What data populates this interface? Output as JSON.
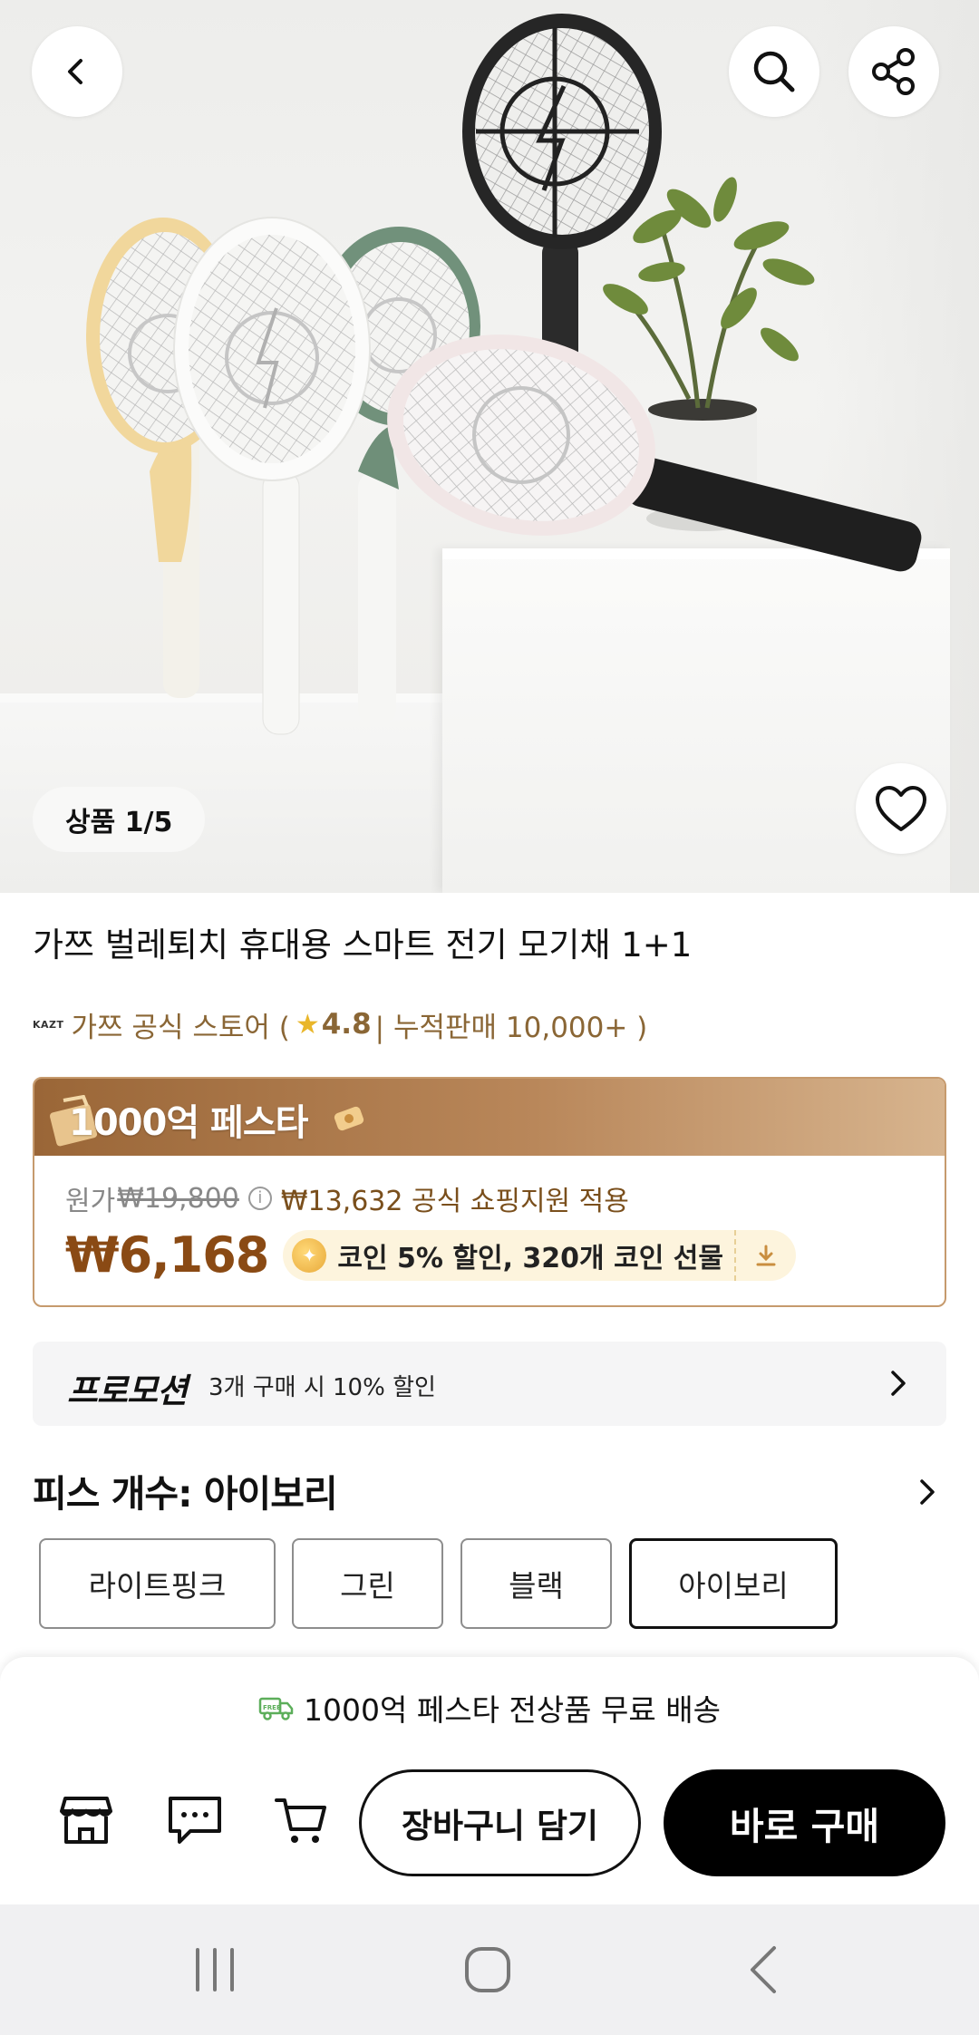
{
  "hero": {
    "page_indicator": "상품 1/5"
  },
  "product": {
    "title": "가쯔 벌레퇴치 휴대용 스마트 전기 모기채 1+1",
    "store_logo": "KAZT",
    "store_name": "가쯔 공식 스토어 (",
    "rating": "4.8",
    "sales": "| 누적판매 10,000+ )"
  },
  "festa": {
    "banner_title": "1000억 페스타",
    "original_label": "원가",
    "original_price": "₩19,800",
    "support_text": "₩13,632 공식 쇼핑지원 적용",
    "final_price": "₩6,168",
    "coin_text": "코인 5% 할인,  320개 코인 선물"
  },
  "promotion": {
    "title": "프로모션",
    "text": "3개 구매 시 10% 할인"
  },
  "options": {
    "title": "피스 개수: 아이보리",
    "items": [
      "라이트핑크",
      "그린",
      "블랙",
      "아이보리"
    ],
    "selected": "아이보리"
  },
  "bottom_sheet": {
    "shipping_text": "1000억 페스타 전상품 무료 배송",
    "cart_label": "장바구니 담기",
    "buy_label": "바로 구매"
  },
  "colors": {
    "accent_brown": "#8a4a14",
    "banner_gold": "#b9875a",
    "buy_black": "#000000",
    "rating_star": "#e9b62a",
    "shipping_green": "#5cae5a"
  }
}
